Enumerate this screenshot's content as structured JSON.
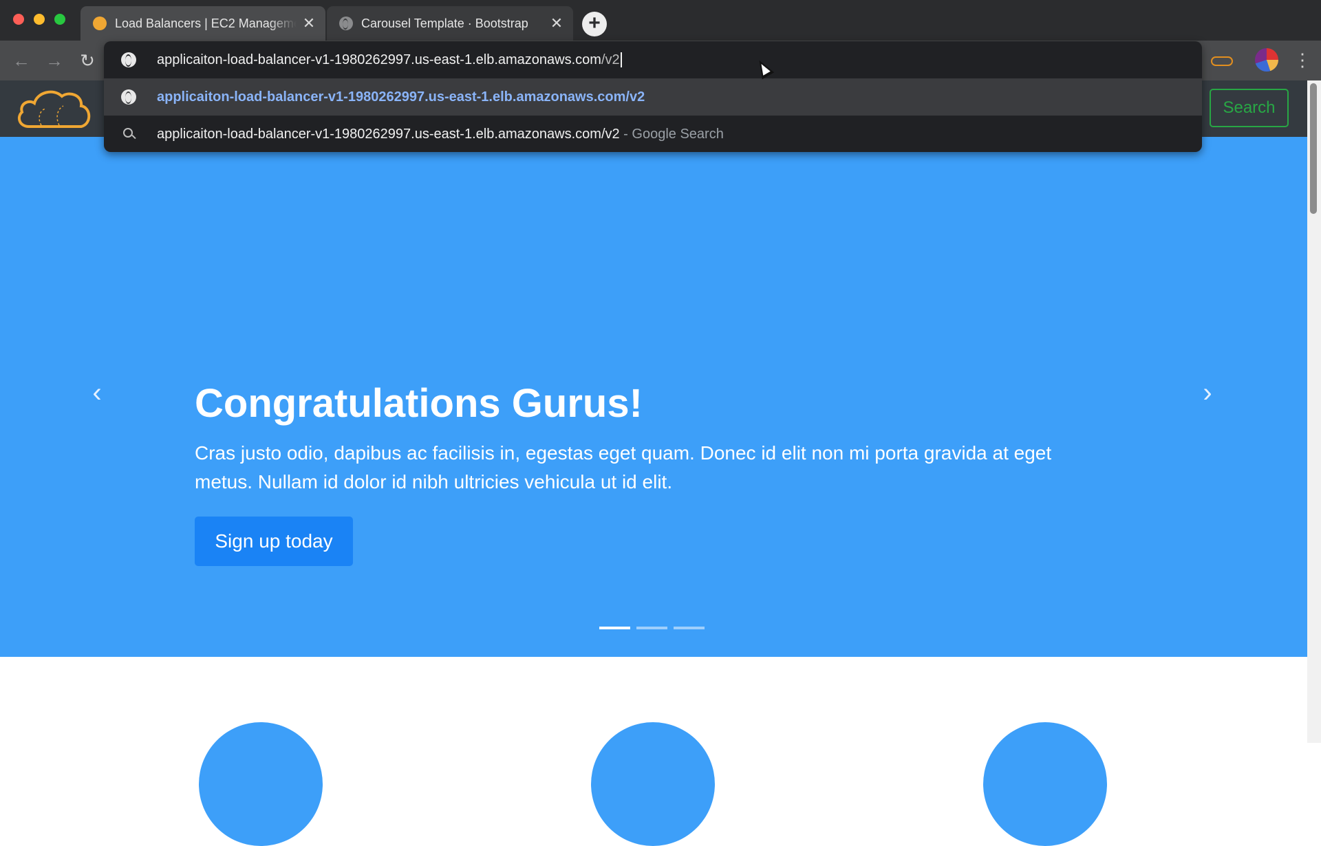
{
  "browser": {
    "tabs": [
      {
        "title": "Load Balancers | EC2 Management Console",
        "active": true,
        "favicon": "aws-icon"
      },
      {
        "title": "Carousel Template · Bootstrap",
        "active": false,
        "favicon": "globe-icon"
      }
    ],
    "close_glyph": "✕",
    "new_tab_glyph": "+",
    "nav": {
      "back": "←",
      "forward": "→",
      "reload": "↻",
      "menu": "⋮"
    }
  },
  "omnibox": {
    "typed_main": "applicaiton-load-balancer-v1-1980262997.us-east-1.elb.amazonaws.com",
    "typed_suffix": "/v2",
    "suggestions": [
      {
        "type": "url",
        "icon": "globe-icon",
        "text": "applicaiton-load-balancer-v1-1980262997.us-east-1.elb.amazonaws.com/v2"
      },
      {
        "type": "search",
        "icon": "search-icon",
        "text": "applicaiton-load-balancer-v1-1980262997.us-east-1.elb.amazonaws.com/v2",
        "suffix": " - Google Search"
      }
    ]
  },
  "page": {
    "navbar": {
      "search_button": "Search"
    },
    "carousel": {
      "title": "Congratulations Gurus!",
      "text": "Cras justo odio, dapibus ac facilisis in, egestas eget quam. Donec id elit non mi porta gravida at eget metus. Nullam id dolor id nibh ultricies vehicula ut id elit.",
      "button": "Sign up today",
      "prev_glyph": "‹",
      "next_glyph": "›",
      "slide_count": 3,
      "active_slide": 1
    }
  },
  "colors": {
    "carousel_bg": "#3d9ff9",
    "navbar_bg": "#343a40",
    "search_green": "#28a745",
    "signup_blue": "#1a83f5",
    "link_blue": "#8ab4f8",
    "logo_orange": "#f0a733"
  }
}
